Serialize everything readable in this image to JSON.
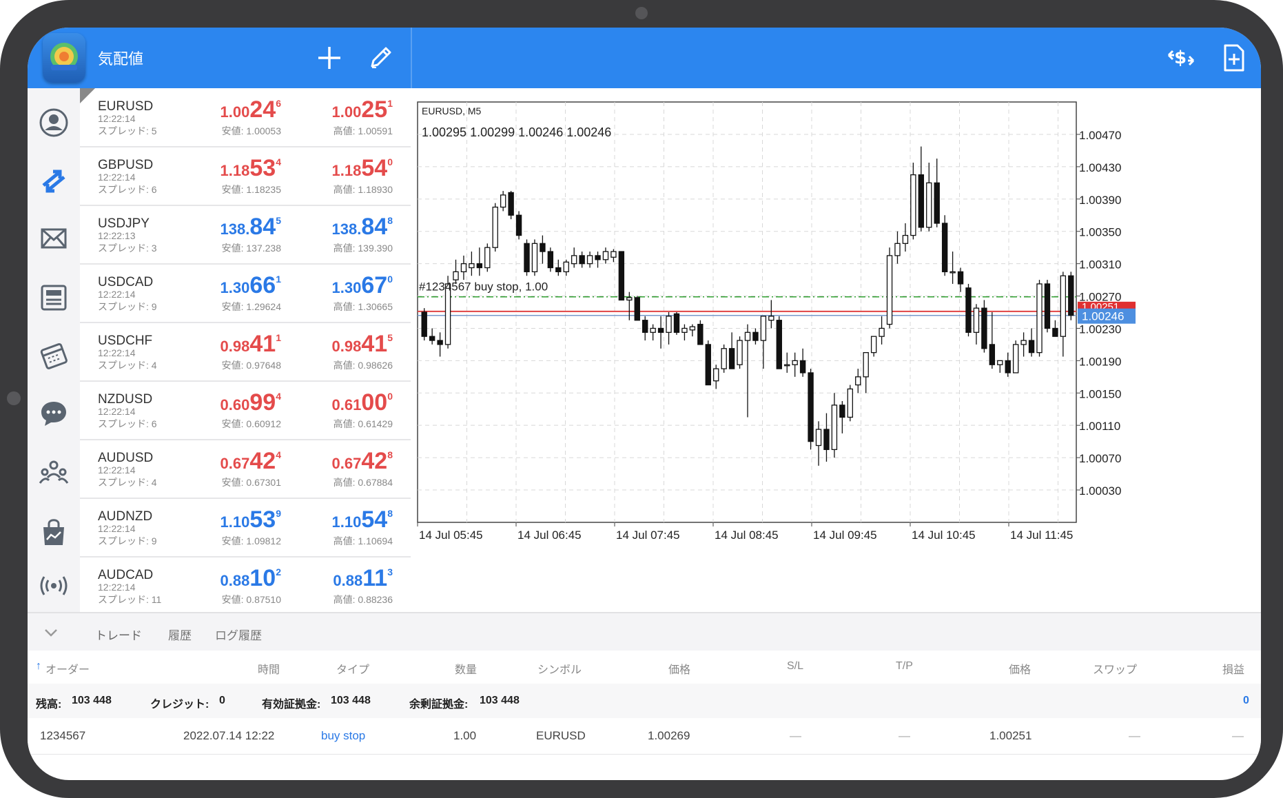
{
  "header": {
    "title": "気配値",
    "add_icon": "plus-icon",
    "edit_icon": "pencil-icon",
    "currency_icon": "currency-switch-icon",
    "new_order_icon": "new-document-icon"
  },
  "rail": {
    "items": [
      "account-icon",
      "trade-arrows-icon",
      "mail-icon",
      "news-icon",
      "calendar-icon",
      "chat-icon",
      "community-icon",
      "market-bag-icon",
      "signal-icon"
    ]
  },
  "quotes": [
    {
      "symbol": "EURUSD",
      "time": "12:22:14",
      "spread": "スプレッド: 5",
      "bid": {
        "a": "1.00",
        "b": "24",
        "c": "6",
        "color": "red"
      },
      "ask": {
        "a": "1.00",
        "b": "25",
        "c": "1",
        "color": "red"
      },
      "low": "安値: 1.00053",
      "high": "高値: 1.00591"
    },
    {
      "symbol": "GBPUSD",
      "time": "12:22:14",
      "spread": "スプレッド: 6",
      "bid": {
        "a": "1.18",
        "b": "53",
        "c": "4",
        "color": "red"
      },
      "ask": {
        "a": "1.18",
        "b": "54",
        "c": "0",
        "color": "red"
      },
      "low": "安値: 1.18235",
      "high": "高値: 1.18930"
    },
    {
      "symbol": "USDJPY",
      "time": "12:22:13",
      "spread": "スプレッド: 3",
      "bid": {
        "a": "138.",
        "b": "84",
        "c": "5",
        "color": "blue"
      },
      "ask": {
        "a": "138.",
        "b": "84",
        "c": "8",
        "color": "blue"
      },
      "low": "安値: 137.238",
      "high": "高値: 139.390"
    },
    {
      "symbol": "USDCAD",
      "time": "12:22:14",
      "spread": "スプレッド: 9",
      "bid": {
        "a": "1.30",
        "b": "66",
        "c": "1",
        "color": "blue"
      },
      "ask": {
        "a": "1.30",
        "b": "67",
        "c": "0",
        "color": "blue"
      },
      "low": "安値: 1.29624",
      "high": "高値: 1.30665"
    },
    {
      "symbol": "USDCHF",
      "time": "12:22:14",
      "spread": "スプレッド: 4",
      "bid": {
        "a": "0.98",
        "b": "41",
        "c": "1",
        "color": "red"
      },
      "ask": {
        "a": "0.98",
        "b": "41",
        "c": "5",
        "color": "red"
      },
      "low": "安値: 0.97648",
      "high": "高値: 0.98626"
    },
    {
      "symbol": "NZDUSD",
      "time": "12:22:14",
      "spread": "スプレッド: 6",
      "bid": {
        "a": "0.60",
        "b": "99",
        "c": "4",
        "color": "red"
      },
      "ask": {
        "a": "0.61",
        "b": "00",
        "c": "0",
        "color": "red"
      },
      "low": "安値: 0.60912",
      "high": "高値: 0.61429"
    },
    {
      "symbol": "AUDUSD",
      "time": "12:22:14",
      "spread": "スプレッド: 4",
      "bid": {
        "a": "0.67",
        "b": "42",
        "c": "4",
        "color": "red"
      },
      "ask": {
        "a": "0.67",
        "b": "42",
        "c": "8",
        "color": "red"
      },
      "low": "安値: 0.67301",
      "high": "高値: 0.67884"
    },
    {
      "symbol": "AUDNZD",
      "time": "12:22:14",
      "spread": "スプレッド: 9",
      "bid": {
        "a": "1.10",
        "b": "53",
        "c": "9",
        "color": "blue"
      },
      "ask": {
        "a": "1.10",
        "b": "54",
        "c": "8",
        "color": "blue"
      },
      "low": "安値: 1.09812",
      "high": "高値: 1.10694"
    },
    {
      "symbol": "AUDCAD",
      "time": "12:22:14",
      "spread": "スプレッド: 11",
      "bid": {
        "a": "0.88",
        "b": "10",
        "c": "2",
        "color": "blue"
      },
      "ask": {
        "a": "0.88",
        "b": "11",
        "c": "3",
        "color": "blue"
      },
      "low": "安値: 0.87510",
      "high": "高値: 0.88236"
    }
  ],
  "chart": {
    "symbol_tf": "EURUSD, M5",
    "ohlc_text": "1.00295 1.00299 1.00246 1.00246",
    "order_line_label": "#1234567    buy stop, 1.00",
    "current_price_label": "1.00246",
    "hidden_price_label": "1.00251",
    "order_price": 1.00269,
    "ask_price": 1.00251,
    "bid_price": 1.00246,
    "colors": {
      "grid": "#d8d8d8",
      "order": "#2e9e2e",
      "ask": "#e04444",
      "bid": "#7799cc",
      "badge": "#4d8fe0",
      "badge_red": "#e03030"
    }
  },
  "chart_data": {
    "type": "candlestick",
    "ylim": [
      1.0,
      1.005
    ],
    "y_ticks": [
      "1.00470",
      "1.00430",
      "1.00390",
      "1.00350",
      "1.00310",
      "1.00270",
      "1.00230",
      "1.00190",
      "1.00150",
      "1.00110",
      "1.00070",
      "1.00030"
    ],
    "y_tick_values": [
      1.0047,
      1.0043,
      1.0039,
      1.0035,
      1.0031,
      1.0027,
      1.0023,
      1.0019,
      1.0015,
      1.0011,
      1.0007,
      1.0003
    ],
    "x_ticks": [
      "14 Jul 05:45",
      "14 Jul 06:45",
      "14 Jul 07:45",
      "14 Jul 08:45",
      "14 Jul 09:45",
      "14 Jul 10:45",
      "14 Jul 11:45"
    ],
    "candles": [
      [
        1.0025,
        1.00255,
        1.00215,
        1.0022
      ],
      [
        1.0022,
        1.0023,
        1.0021,
        1.00215
      ],
      [
        1.00215,
        1.00225,
        1.00195,
        1.0021
      ],
      [
        1.0021,
        1.00295,
        1.00205,
        1.00285
      ],
      [
        1.0029,
        1.00315,
        1.00285,
        1.003
      ],
      [
        1.003,
        1.0032,
        1.0029,
        1.0031
      ],
      [
        1.00305,
        1.00325,
        1.00295,
        1.0031
      ],
      [
        1.0031,
        1.0033,
        1.00295,
        1.00305
      ],
      [
        1.00305,
        1.00335,
        1.003,
        1.0033
      ],
      [
        1.0033,
        1.00385,
        1.00325,
        1.0038
      ],
      [
        1.0038,
        1.004,
        1.00375,
        1.00395
      ],
      [
        1.00398,
        1.004,
        1.00365,
        1.0037
      ],
      [
        1.0037,
        1.00375,
        1.0034,
        1.00345
      ],
      [
        1.00335,
        1.0034,
        1.00295,
        1.003
      ],
      [
        1.003,
        1.0034,
        1.00295,
        1.00335
      ],
      [
        1.00335,
        1.00345,
        1.0031,
        1.00325
      ],
      [
        1.00325,
        1.0033,
        1.003,
        1.00305
      ],
      [
        1.00305,
        1.00315,
        1.00295,
        1.003
      ],
      [
        1.003,
        1.00315,
        1.00295,
        1.00312
      ],
      [
        1.0031,
        1.0033,
        1.00305,
        1.0032
      ],
      [
        1.0032,
        1.00325,
        1.00305,
        1.0031
      ],
      [
        1.0031,
        1.00325,
        1.00305,
        1.0032
      ],
      [
        1.0032,
        1.00325,
        1.00305,
        1.00315
      ],
      [
        1.00315,
        1.0033,
        1.0031,
        1.00325
      ],
      [
        1.00318,
        1.00328,
        1.00312,
        1.00325
      ],
      [
        1.00325,
        1.00325,
        1.00265,
        1.00265
      ],
      [
        1.00265,
        1.00275,
        1.0024,
        1.00268
      ],
      [
        1.00268,
        1.0027,
        1.0024,
        1.0024
      ],
      [
        1.0024,
        1.00245,
        1.00215,
        1.00225
      ],
      [
        1.00225,
        1.00235,
        1.00215,
        1.0023
      ],
      [
        1.0023,
        1.00245,
        1.00205,
        1.00225
      ],
      [
        1.00225,
        1.0025,
        1.0021,
        1.00245
      ],
      [
        1.00248,
        1.0025,
        1.00222,
        1.00225
      ],
      [
        1.00225,
        1.00235,
        1.00215,
        1.0023
      ],
      [
        1.00228,
        1.00235,
        1.0022,
        1.00232
      ],
      [
        1.00235,
        1.0024,
        1.0021,
        1.0021
      ],
      [
        1.0021,
        1.00215,
        1.0016,
        1.0016
      ],
      [
        1.00165,
        1.00185,
        1.00155,
        1.0018
      ],
      [
        1.0018,
        1.0021,
        1.00175,
        1.00205
      ],
      [
        1.00205,
        1.00225,
        1.0018,
        1.0018
      ],
      [
        1.00185,
        1.0022,
        1.0018,
        1.00215
      ],
      [
        1.00215,
        1.00235,
        1.0012,
        1.00225
      ],
      [
        1.00225,
        1.0023,
        1.0021,
        1.00215
      ],
      [
        1.00215,
        1.00245,
        1.0018,
        1.00245
      ],
      [
        1.0024,
        1.00265,
        1.0023,
        1.00245
      ],
      [
        1.0024,
        1.00245,
        1.0018,
        1.0018
      ],
      [
        1.00185,
        1.002,
        1.00175,
        1.00185
      ],
      [
        1.00185,
        1.002,
        1.0017,
        1.0019
      ],
      [
        1.0019,
        1.00205,
        1.0017,
        1.00175
      ],
      [
        1.00175,
        1.0018,
        1.0008,
        1.0009
      ],
      [
        1.00085,
        1.00115,
        1.0006,
        1.00105
      ],
      [
        1.00105,
        1.00125,
        1.00065,
        1.0008
      ],
      [
        1.0008,
        1.0015,
        1.0007,
        1.00135
      ],
      [
        1.00135,
        1.0014,
        1.001,
        1.0012
      ],
      [
        1.0012,
        1.0016,
        1.00115,
        1.00155
      ],
      [
        1.0016,
        1.0018,
        1.0015,
        1.0017
      ],
      [
        1.0017,
        1.002,
        1.0015,
        1.002
      ],
      [
        1.002,
        1.0022,
        1.00195,
        1.0022
      ],
      [
        1.0022,
        1.00245,
        1.0021,
        1.0023
      ],
      [
        1.00235,
        1.0033,
        1.0023,
        1.0032
      ],
      [
        1.0032,
        1.0035,
        1.0031,
        1.00335
      ],
      [
        1.00335,
        1.0036,
        1.00325,
        1.00345
      ],
      [
        1.00345,
        1.00435,
        1.0034,
        1.0042
      ],
      [
        1.0042,
        1.00455,
        1.0035,
        1.00355
      ],
      [
        1.00355,
        1.00435,
        1.0035,
        1.0041
      ],
      [
        1.0041,
        1.0044,
        1.00355,
        1.0036
      ],
      [
        1.0036,
        1.0037,
        1.00295,
        1.003
      ],
      [
        1.003,
        1.00325,
        1.00285,
        1.003
      ],
      [
        1.003,
        1.00305,
        1.00275,
        1.00285
      ],
      [
        1.0028,
        1.00285,
        1.0022,
        1.00225
      ],
      [
        1.00225,
        1.0026,
        1.0021,
        1.00255
      ],
      [
        1.00255,
        1.00265,
        1.002,
        1.00205
      ],
      [
        1.0021,
        1.0025,
        1.0018,
        1.00185
      ],
      [
        1.00185,
        1.0019,
        1.00175,
        1.0019
      ],
      [
        1.0019,
        1.002,
        1.0017,
        1.00175
      ],
      [
        1.00175,
        1.00215,
        1.00175,
        1.0021
      ],
      [
        1.0021,
        1.00225,
        1.00195,
        1.00215
      ],
      [
        1.00215,
        1.0023,
        1.00195,
        1.002
      ],
      [
        1.002,
        1.0029,
        1.00195,
        1.00285
      ],
      [
        1.00285,
        1.0029,
        1.00225,
        1.0023
      ],
      [
        1.0023,
        1.0024,
        1.0022,
        1.0022
      ],
      [
        1.0022,
        1.003,
        1.00195,
        1.00295
      ],
      [
        1.00295,
        1.003,
        1.0024,
        1.00246
      ]
    ]
  },
  "bottom": {
    "collapse_icon": "chevron-down-icon",
    "tabs": [
      "トレード",
      "履歴",
      "ログ履歴"
    ],
    "columns": [
      "オーダー",
      "時間",
      "タイプ",
      "数量",
      "シンボル",
      "価格",
      "S/L",
      "T/P",
      "価格",
      "スワップ",
      "損益"
    ],
    "sort_icon": "sort-up-arrow-icon",
    "balance": {
      "label": "残高:",
      "value": "103 448"
    },
    "credit": {
      "label": "クレジット:",
      "value": "0"
    },
    "equity": {
      "label": "有効証拠金:",
      "value": "103 448"
    },
    "free_margin": {
      "label": "余剰証拠金:",
      "value": "103 448"
    },
    "profit_total": "0",
    "orders": [
      {
        "id": "1234567",
        "time": "2022.07.14 12:22",
        "type": "buy stop",
        "volume": "1.00",
        "symbol": "EURUSD",
        "price": "1.00269",
        "sl": "—",
        "tp": "—",
        "current": "1.00251",
        "swap": "—",
        "profit": "—"
      }
    ]
  }
}
